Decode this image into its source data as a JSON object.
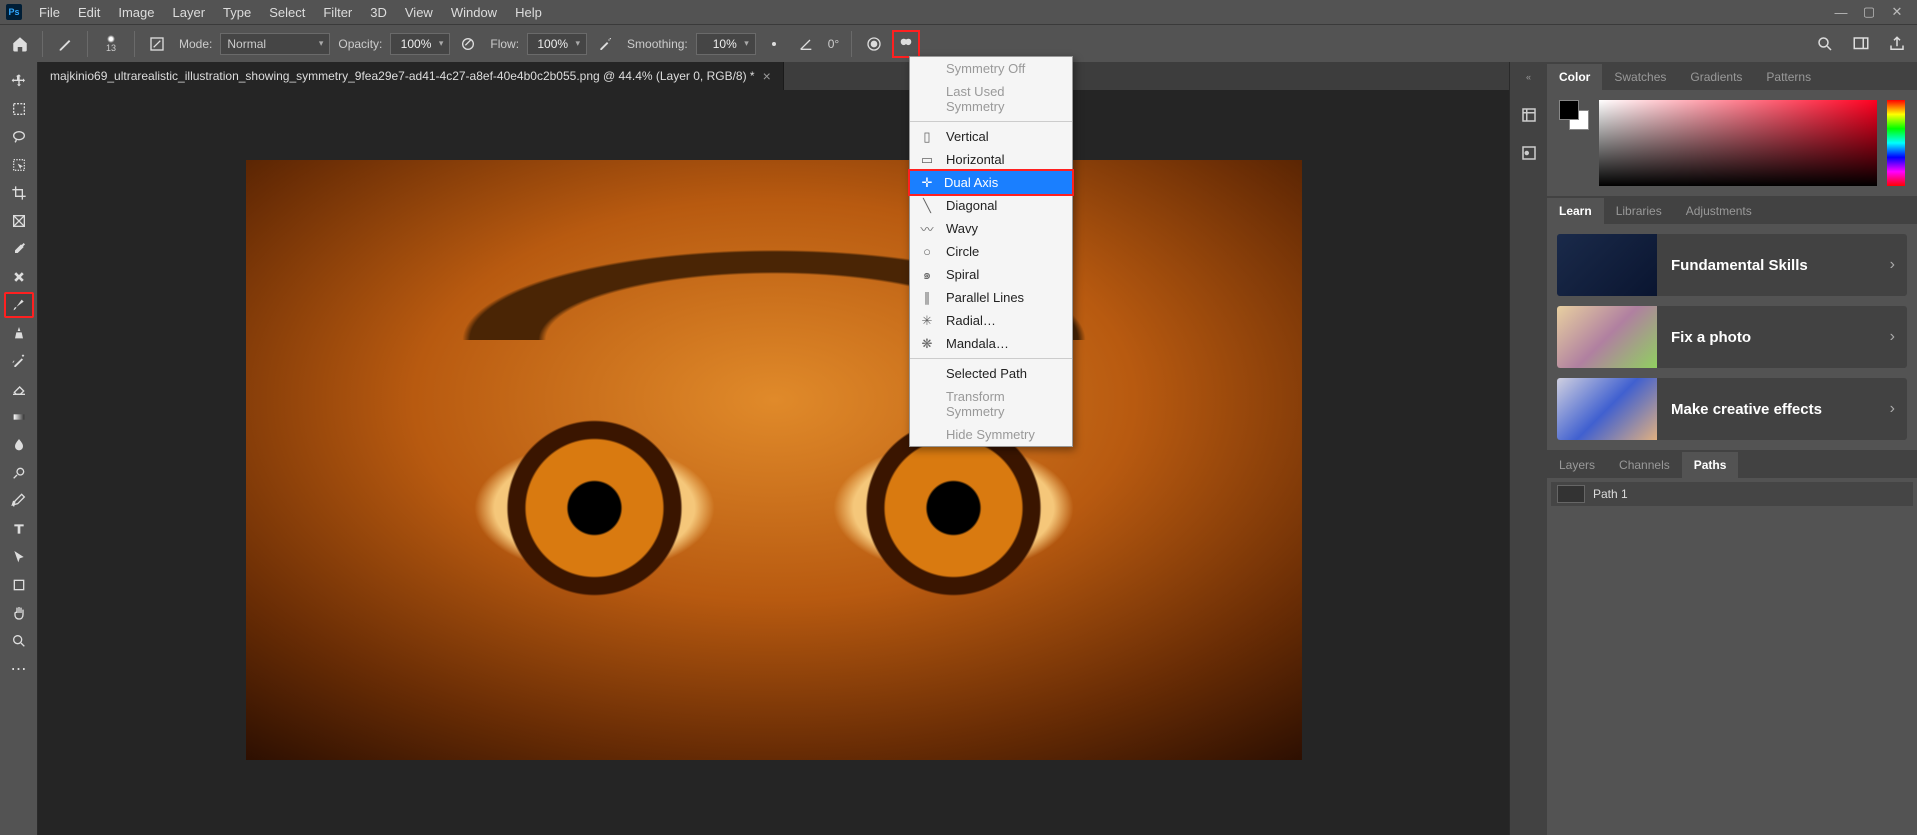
{
  "menu": {
    "items": [
      "File",
      "Edit",
      "Image",
      "Layer",
      "Type",
      "Select",
      "Filter",
      "3D",
      "View",
      "Window",
      "Help"
    ]
  },
  "optbar": {
    "brush_size": "13",
    "mode_label": "Mode:",
    "mode_value": "Normal",
    "opacity_label": "Opacity:",
    "opacity_value": "100%",
    "flow_label": "Flow:",
    "flow_value": "100%",
    "smoothing_label": "Smoothing:",
    "smoothing_value": "10%",
    "angle_value": "0°"
  },
  "doc": {
    "tab_title": "majkinio69_ultrarealistic_illustration_showing_symmetry_9fea29e7-ad41-4c27-a8ef-40e4b0c2b055.png @ 44.4% (Layer 0, RGB/8) *"
  },
  "symmetry": {
    "off": "Symmetry Off",
    "last": "Last Used Symmetry",
    "vertical": "Vertical",
    "horizontal": "Horizontal",
    "dual": "Dual Axis",
    "diagonal": "Diagonal",
    "wavy": "Wavy",
    "circle": "Circle",
    "spiral": "Spiral",
    "parallel": "Parallel Lines",
    "radial": "Radial…",
    "mandala": "Mandala…",
    "selected_path": "Selected Path",
    "transform": "Transform Symmetry",
    "hide": "Hide Symmetry"
  },
  "rp": {
    "color_tabs": [
      "Color",
      "Swatches",
      "Gradients",
      "Patterns"
    ],
    "learn_tabs": [
      "Learn",
      "Libraries",
      "Adjustments"
    ],
    "path_tabs": [
      "Layers",
      "Channels",
      "Paths"
    ],
    "learn_cards": [
      "Fundamental Skills",
      "Fix a photo",
      "Make creative effects"
    ],
    "path1": "Path 1"
  }
}
